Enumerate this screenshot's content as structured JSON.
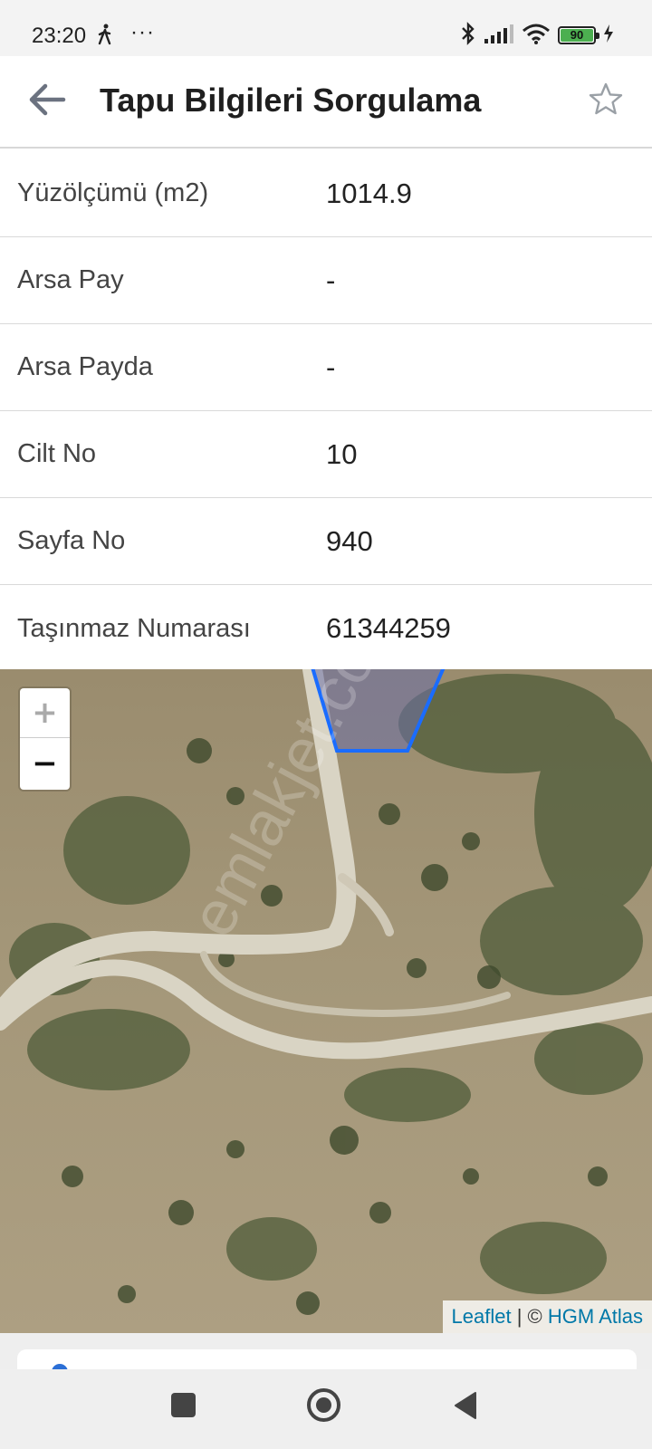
{
  "status_bar": {
    "time": "23:20",
    "dots": "···",
    "battery_level": "90",
    "icons": [
      "walking-icon",
      "bluetooth-icon",
      "signal-icon",
      "wifi-icon",
      "battery-icon",
      "charging-icon"
    ]
  },
  "header": {
    "title": "Tapu Bilgileri Sorgulama",
    "back_icon": "arrow-left-icon",
    "favorite_icon": "star-outline-icon"
  },
  "info_rows": [
    {
      "label": "Yüzölçümü (m2)",
      "value": "1014.9"
    },
    {
      "label": "Arsa Pay",
      "value": "-"
    },
    {
      "label": "Arsa Payda",
      "value": "-"
    },
    {
      "label": "Cilt No",
      "value": "10"
    },
    {
      "label": "Sayfa No",
      "value": "940"
    },
    {
      "label": "Taşınmaz Numarası",
      "value": "61344259"
    }
  ],
  "map": {
    "zoom_in": "+",
    "zoom_out": "−",
    "attribution_leaflet": "Leaflet",
    "attribution_separator": " | © ",
    "attribution_source": "HGM Atlas",
    "parcel_color": "#1a6cff",
    "watermark": "emlakjet.com"
  },
  "colors": {
    "accent": "#2b6fd6",
    "link": "#0078a8",
    "battery_green": "#4caf50"
  }
}
